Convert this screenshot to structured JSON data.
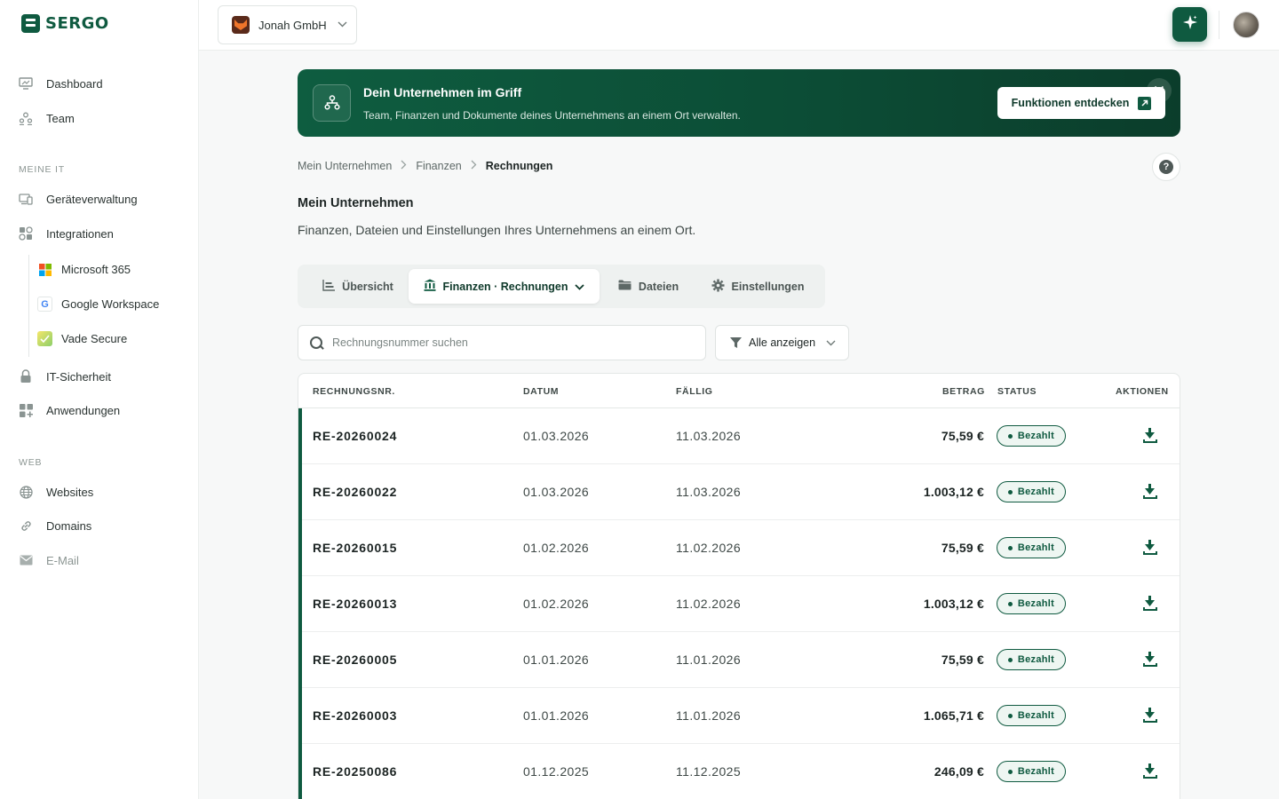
{
  "brand": {
    "name": "SERGO"
  },
  "sidebar": {
    "main": [
      {
        "label": "Dashboard",
        "icon": "dashboard-icon"
      },
      {
        "label": "Team",
        "icon": "team-icon"
      }
    ],
    "section_it": "MEINE IT",
    "it_items": [
      {
        "label": "Geräteverwaltung",
        "icon": "devices-icon"
      },
      {
        "label": "Integrationen",
        "icon": "integrations-icon"
      }
    ],
    "integrations": [
      {
        "label": "Microsoft 365",
        "icon": "microsoft-icon"
      },
      {
        "label": "Google Workspace",
        "icon": "google-icon"
      },
      {
        "label": "Vade Secure",
        "icon": "vade-icon"
      }
    ],
    "it_more": [
      {
        "label": "IT-Sicherheit",
        "icon": "lock-icon"
      },
      {
        "label": "Anwendungen",
        "icon": "apps-icon"
      }
    ],
    "section_web": "WEB",
    "web_items": [
      {
        "label": "Websites",
        "icon": "globe-icon"
      },
      {
        "label": "Domains",
        "icon": "link-icon"
      },
      {
        "label": "E-Mail",
        "icon": "mail-icon"
      }
    ]
  },
  "topbar": {
    "company": "Jonah GmbH"
  },
  "banner": {
    "title": "Dein Unternehmen im Griff",
    "subtitle": "Team, Finanzen und Dokumente deines Unternehmens an einem Ort verwalten.",
    "button": "Funktionen entdecken"
  },
  "breadcrumb": [
    "Mein Unternehmen",
    "Finanzen",
    "Rechnungen"
  ],
  "page": {
    "title": "Mein Unternehmen",
    "subtitle": "Finanzen, Dateien und Einstellungen Ihres Unternehmens an einem Ort."
  },
  "tabs": [
    {
      "label": "Übersicht"
    },
    {
      "label": "Finanzen · Rechnungen",
      "active": true
    },
    {
      "label": "Dateien"
    },
    {
      "label": "Einstellungen"
    }
  ],
  "search": {
    "placeholder": "Rechnungsnummer suchen"
  },
  "filter": {
    "label": "Alle anzeigen"
  },
  "table": {
    "columns": [
      "RECHNUNGSNR.",
      "DATUM",
      "FÄLLIG",
      "BETRAG",
      "STATUS",
      "AKTIONEN"
    ],
    "rows": [
      {
        "number": "RE-20260024",
        "date": "01.03.2026",
        "due": "11.03.2026",
        "amount": "75,59 €",
        "status": "Bezahlt"
      },
      {
        "number": "RE-20260022",
        "date": "01.03.2026",
        "due": "11.03.2026",
        "amount": "1.003,12 €",
        "status": "Bezahlt"
      },
      {
        "number": "RE-20260015",
        "date": "01.02.2026",
        "due": "11.02.2026",
        "amount": "75,59 €",
        "status": "Bezahlt"
      },
      {
        "number": "RE-20260013",
        "date": "01.02.2026",
        "due": "11.02.2026",
        "amount": "1.003,12 €",
        "status": "Bezahlt"
      },
      {
        "number": "RE-20260005",
        "date": "01.01.2026",
        "due": "11.01.2026",
        "amount": "75,59 €",
        "status": "Bezahlt"
      },
      {
        "number": "RE-20260003",
        "date": "01.01.2026",
        "due": "11.01.2026",
        "amount": "1.065,71 €",
        "status": "Bezahlt"
      },
      {
        "number": "RE-20250086",
        "date": "01.12.2025",
        "due": "11.12.2025",
        "amount": "246,09 €",
        "status": "Bezahlt"
      }
    ]
  },
  "colors": {
    "brand": "#0f5a40",
    "background": "#f7f8f8"
  }
}
